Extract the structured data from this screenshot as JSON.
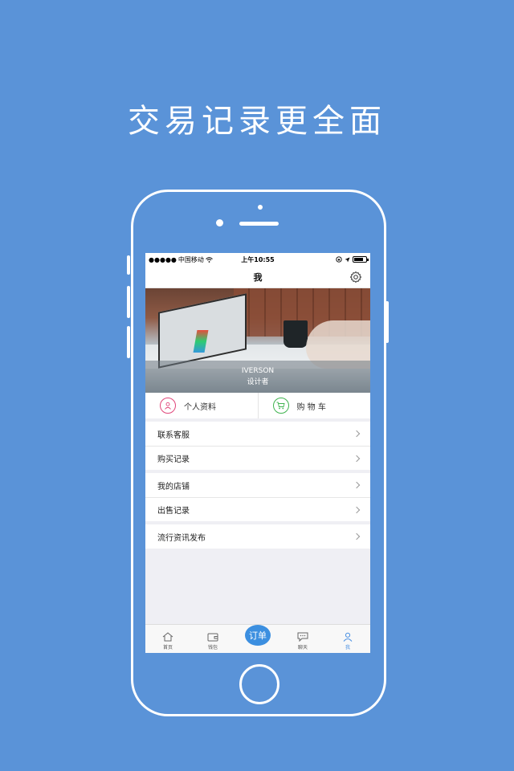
{
  "headline": "交易记录更全面",
  "status_bar": {
    "carrier": "中国移动",
    "time": "上午10:55"
  },
  "navbar": {
    "title": "我"
  },
  "profile": {
    "name": "IVERSON",
    "role": "设计者"
  },
  "quick_actions": [
    {
      "label": "个人资料",
      "icon": "person-icon",
      "color": "#e0467a"
    },
    {
      "label": "购 物 车",
      "icon": "cart-icon",
      "color": "#3fb34f"
    }
  ],
  "menu_groups": [
    [
      {
        "label": "联系客服"
      },
      {
        "label": "购买记录"
      }
    ],
    [
      {
        "label": "我的店铺"
      },
      {
        "label": "出售记录"
      }
    ],
    [
      {
        "label": "流行资讯发布"
      }
    ]
  ],
  "tabbar": {
    "tabs": [
      {
        "label": "首页",
        "icon": "home-icon"
      },
      {
        "label": "钱包",
        "icon": "wallet-icon"
      },
      {
        "label": "订单",
        "icon": "order-button"
      },
      {
        "label": "聊天",
        "icon": "chat-icon"
      },
      {
        "label": "我",
        "icon": "me-icon"
      }
    ],
    "active_index": 4
  },
  "colors": {
    "background": "#5a93d8",
    "accent": "#3c8fe0"
  }
}
